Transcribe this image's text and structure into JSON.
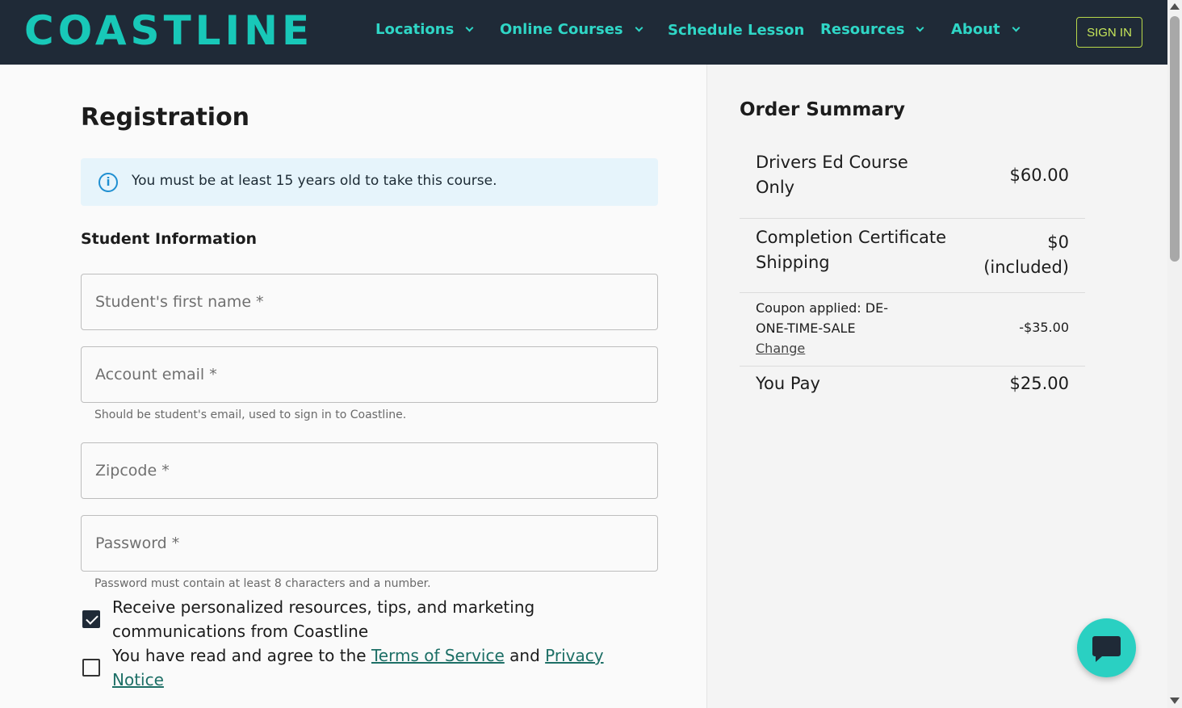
{
  "header": {
    "logo": "COASTLINE",
    "nav": [
      {
        "label": "Locations",
        "has_dropdown": true
      },
      {
        "label": "Online Courses",
        "has_dropdown": true
      },
      {
        "label": "Schedule Lesson",
        "has_dropdown": false
      },
      {
        "label": "Resources",
        "has_dropdown": true
      },
      {
        "label": "About",
        "has_dropdown": true
      }
    ],
    "sign_in_label": "SIGN IN"
  },
  "form": {
    "title": "Registration",
    "notice": "You must be at least 15 years old to take this course.",
    "section_title": "Student Information",
    "fields": {
      "first_name": {
        "placeholder": "Student's first name *",
        "value": ""
      },
      "email": {
        "placeholder": "Account email *",
        "value": "",
        "helper": "Should be student's email, used to sign in to Coastline."
      },
      "zipcode": {
        "placeholder": "Zipcode *",
        "value": ""
      },
      "password": {
        "placeholder": "Password *",
        "value": "",
        "helper": "Password must contain at least 8 characters and a number."
      }
    },
    "marketing_checkbox": {
      "checked": true,
      "label": "Receive personalized resources, tips, and marketing communications from Coastline"
    },
    "terms_checkbox": {
      "checked": false,
      "prefix": "You have read and agree to the",
      "terms_link": "Terms of Service",
      "conjunction": "and",
      "privacy_link": "Privacy Notice"
    }
  },
  "order_summary": {
    "title": "Order Summary",
    "course": {
      "label": "Drivers Ed Course Only",
      "price": "$60.00"
    },
    "shipping": {
      "label": "Completion Certificate Shipping",
      "price": "$0 (included)"
    },
    "coupon": {
      "label": "Coupon applied: DE-ONE-TIME-SALE",
      "change_label": "Change",
      "amount": "-$35.00"
    },
    "total": {
      "label": "You Pay",
      "price": "$25.00"
    }
  },
  "colors": {
    "header_bg": "#1f2a37",
    "brand_teal": "#18c8b8",
    "sign_in_accent": "#c8e85a",
    "info_blue": "#1f8fd1"
  }
}
